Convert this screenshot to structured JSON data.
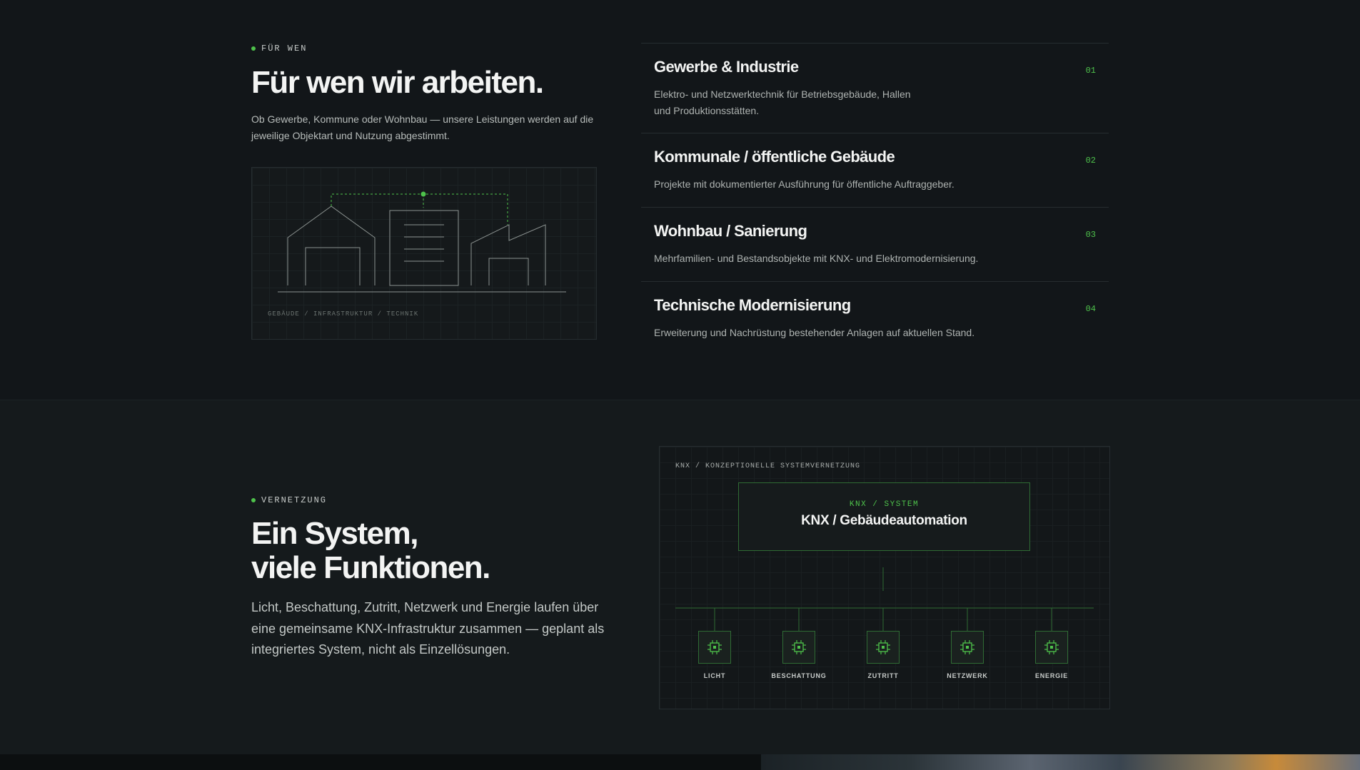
{
  "section1": {
    "eyebrow": "FÜR WEN",
    "title": "Für wen wir arbeiten.",
    "lead_line1": "Ob Gewerbe, Kommune oder Wohnbau — unsere Leistungen werden auf die",
    "lead_line2": "jeweilige Objektart und Nutzung abgestimmt.",
    "illustration_caption": "GEBÄUDE / INFRASTRUKTUR / TECHNIK",
    "items": [
      {
        "title": "Gewerbe & Industrie",
        "number": "01",
        "desc_line1": "Elektro- und Netzwerktechnik für Betriebsgebäude, Hallen",
        "desc_line2": "und Produktionsstätten."
      },
      {
        "title": "Kommunale / öffentliche Gebäude",
        "number": "02",
        "desc_line1": "Projekte mit dokumentierter Ausführung für öffentliche Auftraggeber.",
        "desc_line2": ""
      },
      {
        "title": "Wohnbau / Sanierung",
        "number": "03",
        "desc_line1": "Mehrfamilien- und Bestandsobjekte mit KNX- und Elektromodernisierung.",
        "desc_line2": ""
      },
      {
        "title": "Technische Modernisierung",
        "number": "04",
        "desc_line1": "Erweiterung und Nachrüstung bestehender Anlagen auf aktuellen Stand.",
        "desc_line2": ""
      }
    ]
  },
  "section2": {
    "eyebrow": "VERNETZUNG",
    "title_line1": "Ein System,",
    "title_line2": "viele Funktionen.",
    "lead_line1": "Licht, Beschattung, Zutritt, Netzwerk und Energie laufen über",
    "lead_line2": "eine gemeinsame KNX-Infrastruktur zusammen — geplant als",
    "lead_line3": "integriertes System, nicht als Einzellösungen.",
    "diagram": {
      "caption": "KNX / KONZEPTIONELLE SYSTEMVERNETZUNG",
      "core_kicker": "KNX / SYSTEM",
      "core_title": "KNX / Gebäudeautomation",
      "nodes": [
        "LICHT",
        "BESCHATTUNG",
        "ZUTRITT",
        "NETZWERK",
        "ENERGIE"
      ],
      "node_icon": "chip-icon"
    }
  },
  "colors": {
    "accent": "#4ec24b",
    "background": "#121619",
    "border": "#262d30"
  }
}
